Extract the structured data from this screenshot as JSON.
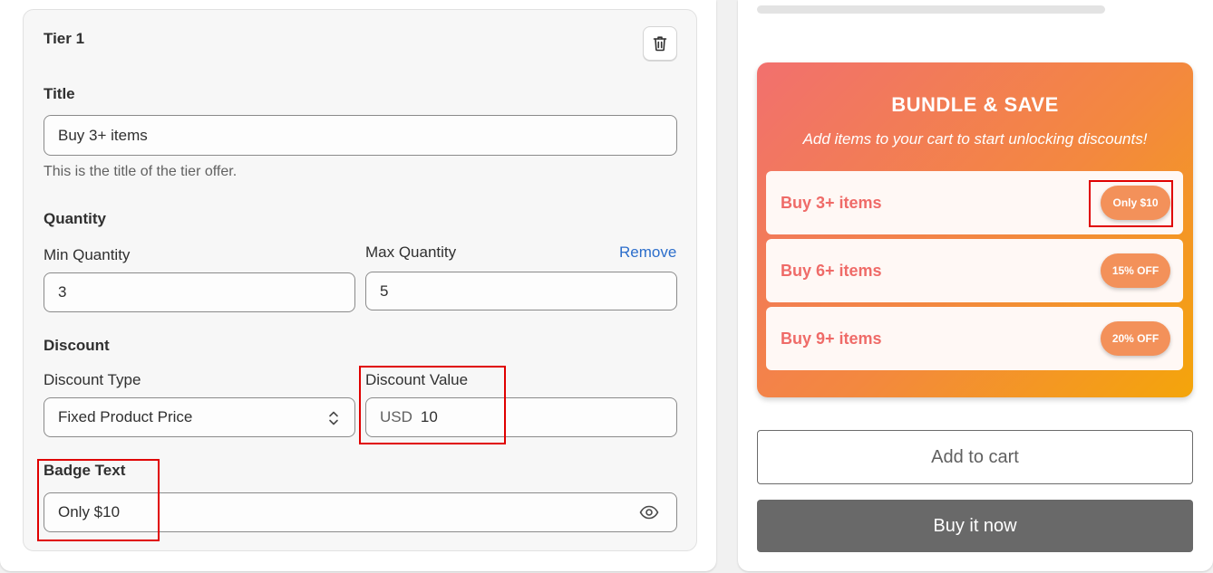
{
  "tier": {
    "title": "Tier 1",
    "title_section": {
      "heading": "Title",
      "value": "Buy 3+ items",
      "help": "This is the title of the tier offer."
    },
    "quantity": {
      "heading": "Quantity",
      "min_label": "Min Quantity",
      "min_value": "3",
      "max_label": "Max Quantity",
      "max_value": "5",
      "remove_label": "Remove"
    },
    "discount": {
      "heading": "Discount",
      "type_label": "Discount Type",
      "type_value": "Fixed Product Price",
      "value_label": "Discount Value",
      "currency": "USD",
      "value": "10"
    },
    "badge": {
      "label": "Badge Text",
      "value": "Only $10"
    }
  },
  "preview": {
    "title": "BUNDLE & SAVE",
    "subtitle": "Add items to your cart to start unlocking discounts!",
    "tiers": [
      {
        "label": "Buy 3+ items",
        "badge": "Only $10"
      },
      {
        "label": "Buy 6+ items",
        "badge": "15% OFF"
      },
      {
        "label": "Buy 9+ items",
        "badge": "20% OFF"
      }
    ],
    "add_to_cart": "Add to cart",
    "buy_now": "Buy it now"
  },
  "colors": {
    "accent_link": "#2c6ecb",
    "highlight": "#e00000",
    "gradient_start": "#f2706e",
    "gradient_end": "#f4a50a",
    "tier_text": "#ef6b68",
    "badge_bg": "#f3915a",
    "buy_now_bg": "#696969"
  },
  "icons": [
    "trash-icon",
    "select-arrows-icon",
    "eye-icon"
  ]
}
